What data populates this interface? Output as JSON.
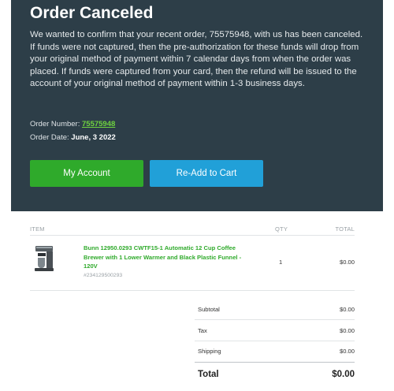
{
  "hero": {
    "title": "Order Canceled",
    "message": "We wanted to confirm that your recent order, 75575948, with us has been canceled. If funds were not captured, then the pre-authorization for these funds will drop from your original method of payment within 7 calendar days from when the order was placed. If funds were captured from your card, then the refund will be issued to the account of your original method of payment within 1-3 business days.",
    "order_number_label": "Order Number:",
    "order_number": "75575948",
    "order_date_label": "Order Date:",
    "order_date": "June, 3 2022",
    "account_button": "My Account",
    "readd_button": "Re-Add to Cart"
  },
  "table": {
    "headers": {
      "item": "ITEM",
      "qty": "QTY",
      "total": "TOTAL"
    },
    "items": [
      {
        "name": "Bunn 12950.0293 CWTF15-1 Automatic 12 Cup Coffee Brewer with 1 Lower Warmer and Black Plastic Funnel - 120V",
        "sku": "#234129500293",
        "qty": "1",
        "total": "$0.00"
      }
    ]
  },
  "summary": {
    "subtotal_label": "Subtotal",
    "subtotal": "$0.00",
    "tax_label": "Tax",
    "tax": "$0.00",
    "shipping_label": "Shipping",
    "shipping": "$0.00",
    "total_label": "Total",
    "total": "$0.00"
  },
  "colors": {
    "header_bg": "#2d3e48",
    "accent_green": "#2faa2b",
    "accent_blue": "#21a0d8"
  }
}
